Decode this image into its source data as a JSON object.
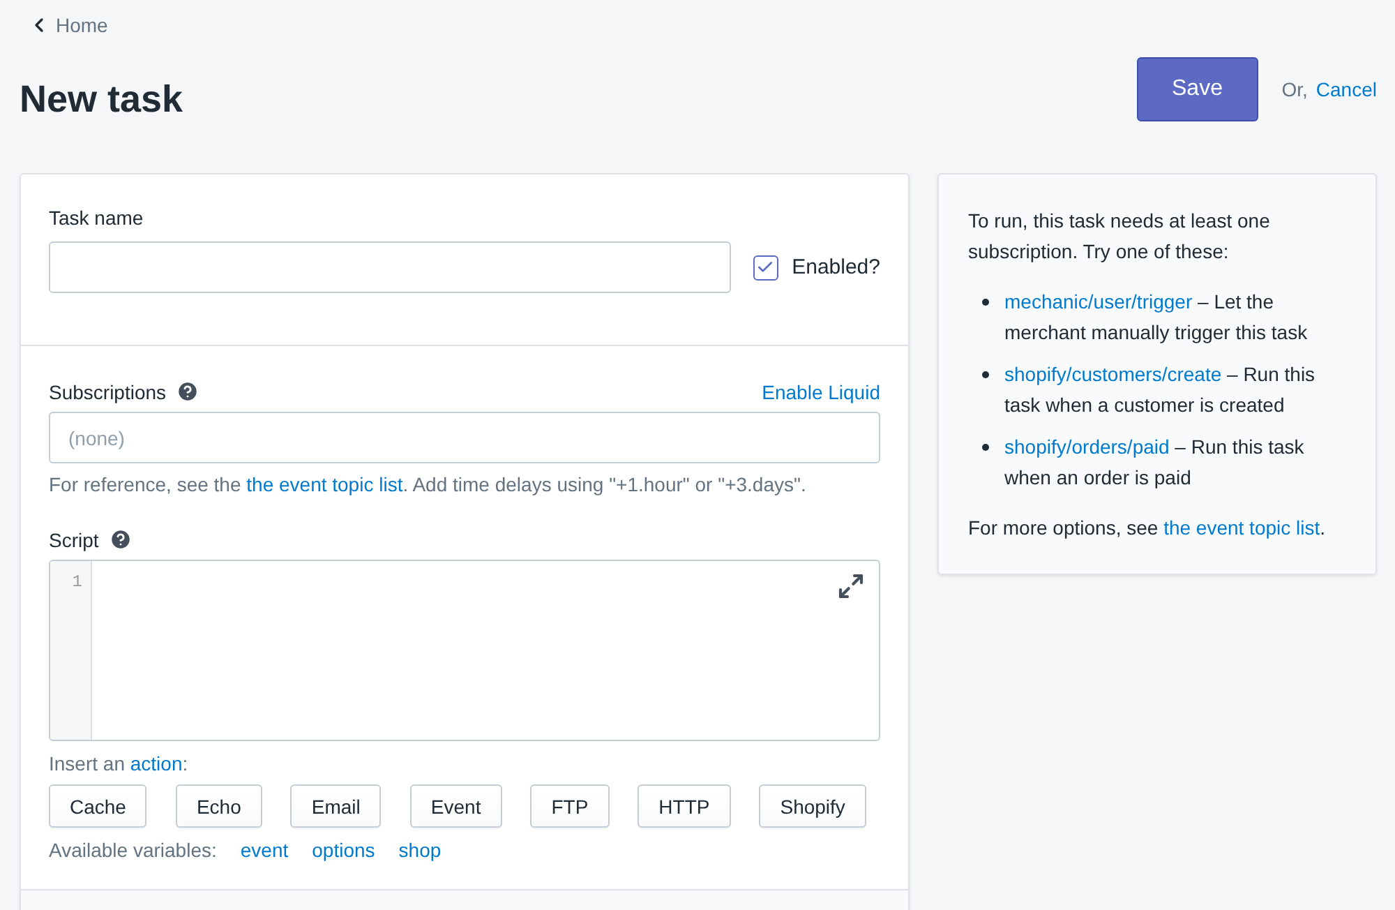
{
  "breadcrumb": {
    "label": "Home"
  },
  "title": "New task",
  "actions": {
    "save": "Save",
    "or": "Or,",
    "cancel": "Cancel"
  },
  "task_name": {
    "label": "Task name"
  },
  "enabled": {
    "label": "Enabled?",
    "checked": true
  },
  "subscriptions": {
    "label": "Subscriptions",
    "liquid_link": "Enable Liquid",
    "placeholder": "(none)",
    "help": {
      "before": "For reference, see the ",
      "link": "the event topic list",
      "after": ". Add time delays using \"+1.hour\" or \"+3.days\"."
    }
  },
  "script": {
    "label": "Script",
    "line_numbers": [
      "1"
    ]
  },
  "insert_action": {
    "before": "Insert an ",
    "link": "action",
    "after": ":"
  },
  "action_buttons": [
    "Cache",
    "Echo",
    "Email",
    "Event",
    "FTP",
    "HTTP",
    "Shopify"
  ],
  "variables": {
    "label": "Available variables:",
    "items": [
      "event",
      "options",
      "shop"
    ]
  },
  "sidebar": {
    "intro": "To run, this task needs at least one subscription. Try one of these:",
    "suggestions": [
      {
        "topic": "mechanic/user/trigger",
        "description": " – Let the merchant manually trigger this task"
      },
      {
        "topic": "shopify/customers/create",
        "description": " – Run this task when a customer is created"
      },
      {
        "topic": "shopify/orders/paid",
        "description": " – Run this task when an order is paid"
      }
    ],
    "more": {
      "before": "For more options, see ",
      "link": "the event topic list",
      "after": "."
    }
  }
}
